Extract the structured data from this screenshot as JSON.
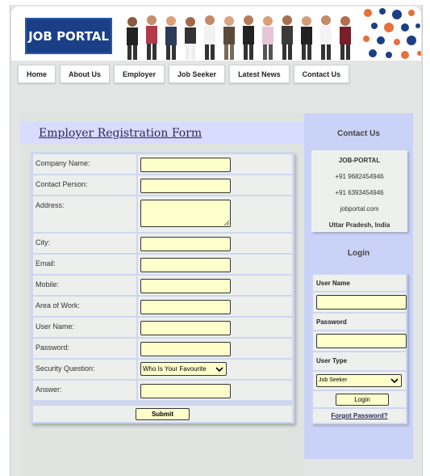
{
  "header": {
    "logo_text": "JOB PORTAL"
  },
  "nav": {
    "items": [
      "Home",
      "About Us",
      "Employer",
      "Job Seeker",
      "Latest News",
      "Contact Us"
    ]
  },
  "form": {
    "title": "Employer Registration Form",
    "fields": {
      "company_name": "Company Name:",
      "contact_person": "Contact Person:",
      "address": "Address:",
      "city": "City:",
      "email": "Email:",
      "mobile": "Mobile:",
      "area_of_work": "Area of Work:",
      "user_name": "User Name:",
      "password": "Password:",
      "security_question": "Security Question:",
      "answer": "Answer:"
    },
    "security_question_value": "Who Is Your Favourite",
    "submit_label": "Submit"
  },
  "sidebar": {
    "contact_title": "Contact Us",
    "contact": {
      "name": "JOB-PORTAL",
      "phone1": "+91 9682454946",
      "phone2": "+91 6393454946",
      "website": "jobportal.com",
      "location": "Uttar Pradesh, India"
    },
    "login_title": "Login",
    "login": {
      "user_name_label": "User Name",
      "password_label": "Password",
      "user_type_label": "User Type",
      "user_type_value": "Job Seeker",
      "login_button": "Login",
      "forgot_password": "Forgot Password?"
    }
  },
  "colors": {
    "logo_bg": "#1a3f86",
    "input_bg": "#ffffcc",
    "sidebar_bg": "#c9d3f7",
    "form_header_bg": "#d8dcff"
  }
}
